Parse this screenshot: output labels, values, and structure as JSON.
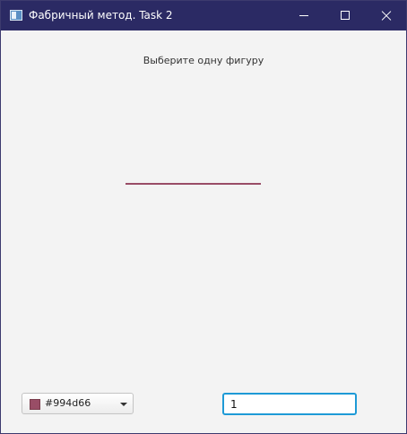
{
  "window": {
    "title": "Фабричный метод. Task 2"
  },
  "main": {
    "prompt": "Выберите одну фигуру"
  },
  "shape": {
    "type": "line",
    "color": "#994d66"
  },
  "controls": {
    "color_picker": {
      "value": "#994d66",
      "swatch_color": "#994d66"
    },
    "size_input": {
      "value": "1"
    }
  }
}
